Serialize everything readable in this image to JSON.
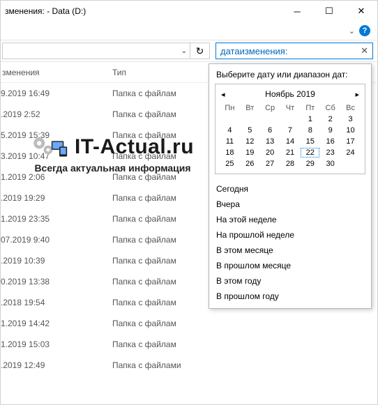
{
  "window": {
    "title": "зменения: - Data (D:)"
  },
  "search": {
    "query": "датаизменения:"
  },
  "columns": {
    "modified": "зменения",
    "type": "Тип"
  },
  "rows": [
    {
      "date": "9.2019 16:49",
      "type": "Папка с файлам"
    },
    {
      "date": ".2019 2:52",
      "type": "Папка с файлам"
    },
    {
      "date": "5.2019 15:39",
      "type": "Папка с файлам"
    },
    {
      "date": "3.2019 10:47",
      "type": "Папка с файлам"
    },
    {
      "date": "1.2019 2:06",
      "type": "Папка с файлам"
    },
    {
      "date": ".2019 19:29",
      "type": "Папка с файлам"
    },
    {
      "date": "1.2019 23:35",
      "type": "Папка с файлам"
    },
    {
      "date": "07.2019 9:40",
      "type": "Папка с файлам"
    },
    {
      "date": ".2019 10:39",
      "type": "Папка с файлам"
    },
    {
      "date": "0.2019 13:38",
      "type": "Папка с файлам"
    },
    {
      "date": ".2018 19:54",
      "type": "Папка с файлам"
    },
    {
      "date": "1.2019 14:42",
      "type": "Папка с файлам"
    },
    {
      "date": "1.2019 15:03",
      "type": "Папка с файлам"
    },
    {
      "date": ".2019 12:49",
      "type": "Папка с файлами"
    }
  ],
  "dropdown": {
    "hint": "Выберите дату или диапазон дат:",
    "month": "Ноябрь 2019",
    "dow": [
      "Пн",
      "Вт",
      "Ср",
      "Чт",
      "Пт",
      "Сб",
      "Вс"
    ],
    "today": 22,
    "options": [
      "Сегодня",
      "Вчера",
      "На этой неделе",
      "На прошлой неделе",
      "В этом месяце",
      "В прошлом месяце",
      "В этом году",
      "В прошлом году"
    ]
  },
  "watermark": {
    "site": "IT-Actual.ru",
    "tagline": "Всегда актуальная информация"
  }
}
